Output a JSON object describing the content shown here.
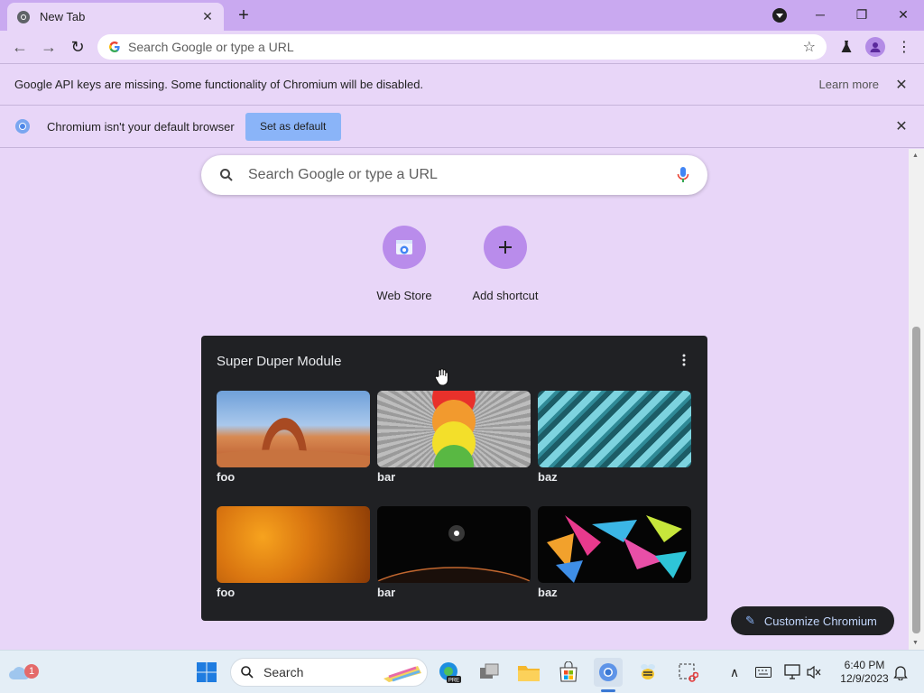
{
  "tab": {
    "title": "New Tab"
  },
  "toolbar": {
    "omnibox_placeholder": "Search Google or type a URL"
  },
  "infobars": {
    "api_keys": {
      "text": "Google API keys are missing. Some functionality of Chromium will be disabled.",
      "learn_more": "Learn more"
    },
    "default_browser": {
      "text": "Chromium isn't your default browser",
      "button": "Set as default"
    }
  },
  "ntp": {
    "search_placeholder": "Search Google or type a URL",
    "shortcuts": [
      {
        "label": "Web Store",
        "icon": "web-store-icon"
      },
      {
        "label": "Add shortcut",
        "icon": "plus-icon"
      }
    ],
    "module": {
      "title": "Super Duper Module",
      "tiles": [
        {
          "label": "foo",
          "image": "desert-arch-photo"
        },
        {
          "label": "bar",
          "image": "stacked-circles-art"
        },
        {
          "label": "baz",
          "image": "glass-building-photo"
        },
        {
          "label": "foo",
          "image": "orange-texture-photo"
        },
        {
          "label": "bar",
          "image": "planet-horizon-photo"
        },
        {
          "label": "baz",
          "image": "paint-splash-art"
        }
      ]
    },
    "customize_label": "Customize Chromium"
  },
  "taskbar": {
    "search_label": "Search",
    "weather_badge": "1",
    "time": "6:40 PM",
    "date": "12/9/2023"
  },
  "colors": {
    "frame": "#c9a9f0",
    "background": "#e8d6f8",
    "module": "#202124",
    "accent_blue": "#8ab4f8"
  }
}
